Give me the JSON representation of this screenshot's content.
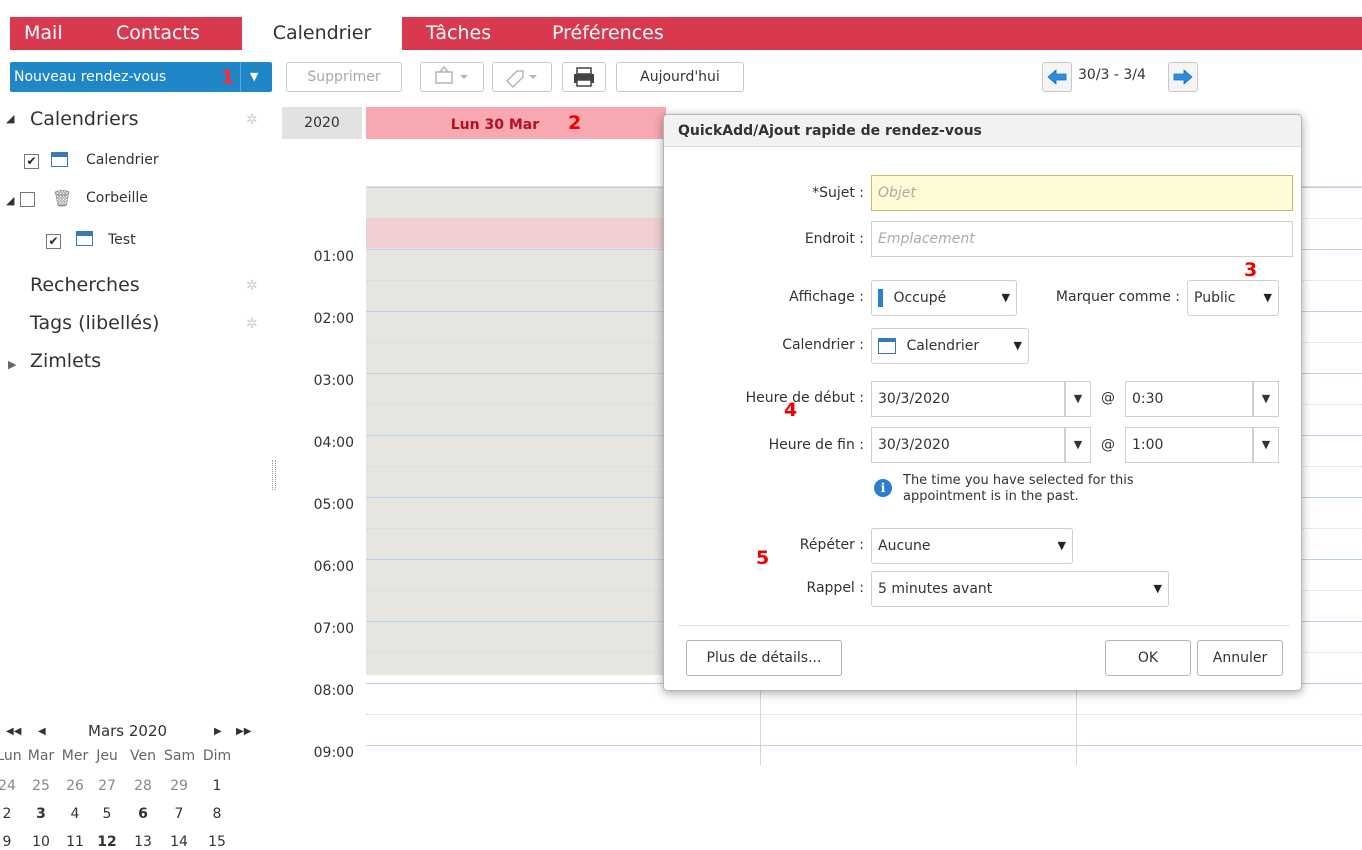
{
  "nav": {
    "tabs": [
      {
        "label": "Mail"
      },
      {
        "label": "Contacts"
      },
      {
        "label": "Calendrier"
      },
      {
        "label": "Tâches"
      },
      {
        "label": "Préférences"
      }
    ]
  },
  "toolbar": {
    "new_label": "Nouveau rendez-vous",
    "delete_label": "Supprimer",
    "today_label": "Aujourd'hui",
    "date_range": "30/3 - 3/4",
    "annotation_1": "1"
  },
  "sidebar": {
    "calendars_label": "Calendriers",
    "calendar_item": "Calendrier",
    "trash_item": "Corbeille",
    "test_item": "Test",
    "searches_label": "Recherches",
    "tags_label": "Tags (libellés)",
    "zimlets_label": "Zimlets"
  },
  "minical": {
    "title": "Mars 2020",
    "weekdays": [
      "Lun",
      "Mar",
      "Mer",
      "Jeu",
      "Ven",
      "Sam",
      "Dim"
    ],
    "weeks": [
      [
        "24",
        "25",
        "26",
        "27",
        "28",
        "29",
        "1"
      ],
      [
        "2",
        "3",
        "4",
        "5",
        "6",
        "7",
        "8"
      ],
      [
        "9",
        "10",
        "11",
        "12",
        "13",
        "14",
        "15"
      ]
    ]
  },
  "calendar": {
    "year": "2020",
    "day_header": "Lun 30 Mar",
    "annotation_2": "2",
    "times": [
      "01:00",
      "02:00",
      "03:00",
      "04:00",
      "05:00",
      "06:00",
      "07:00",
      "08:00",
      "09:00"
    ]
  },
  "dialog": {
    "title": "QuickAdd/Ajout rapide de rendez-vous",
    "subject_label": "*Sujet :",
    "subject_placeholder": "Objet",
    "location_label": "Endroit :",
    "location_placeholder": "Emplacement",
    "display_label": "Affichage :",
    "display_value": "Occupé",
    "mark_label": "Marquer comme :",
    "mark_value": "Public",
    "annotation_3": "3",
    "calendar_label": "Calendrier :",
    "calendar_value": "Calendrier",
    "start_label": "Heure de début :",
    "start_date": "30/3/2020",
    "start_time": "0:30",
    "annotation_4": "4",
    "end_label": "Heure de fin :",
    "end_date": "30/3/2020",
    "end_time": "1:00",
    "at_sign": "@",
    "past_warning_line1": "The time you have selected for this",
    "past_warning_line2": "appointment is in the past.",
    "repeat_label": "Répéter :",
    "repeat_value": "Aucune",
    "annotation_5": "5",
    "reminder_label": "Rappel :",
    "reminder_value": "5 minutes avant",
    "more_details_label": "Plus de détails...",
    "ok_label": "OK",
    "cancel_label": "Annuler"
  },
  "colors": {
    "nav_red": "#d9394e",
    "primary_blue": "#1f86c7",
    "annotation_red": "#e00000"
  }
}
